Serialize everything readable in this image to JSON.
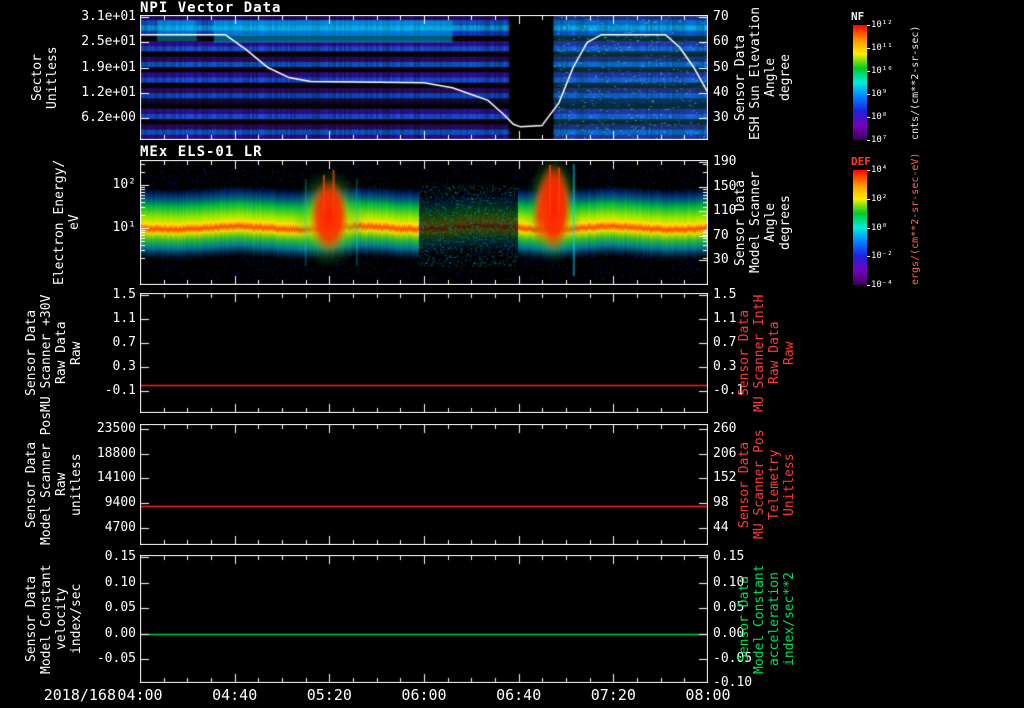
{
  "x_axis": {
    "date_label": "2018/168",
    "tick_labels": [
      "04:00",
      "04:40",
      "05:20",
      "06:00",
      "06:40",
      "07:20",
      "08:00"
    ],
    "start_hour": 4,
    "end_hour": 8
  },
  "panels": [
    {
      "title": "NPI Vector Data",
      "left_label_lines": [
        "Sector",
        "Unitless"
      ],
      "left_ticks": [
        "3.1e+01",
        "2.5e+01",
        "1.9e+01",
        "1.2e+01",
        "6.2e+00"
      ],
      "right_ticks": [
        "70",
        "60",
        "50",
        "40",
        "30"
      ],
      "right_label_lines": [
        "Sensor Data",
        "ESH Sun Elevation",
        "Angle",
        "degree"
      ],
      "right_label_color": "#ffffff"
    },
    {
      "title": "MEx ELS-01 LR",
      "left_label_lines": [
        "Electron Energy/",
        "eV"
      ],
      "left_ticks": [
        "10²",
        "10¹"
      ],
      "right_ticks": [
        "190",
        "150",
        "110",
        "70",
        "30"
      ],
      "right_label_lines": [
        "Sensor Data",
        "Model Scanner",
        "Angle",
        "degrees"
      ],
      "right_label_color": "#ffffff"
    },
    {
      "title": "",
      "left_label_lines": [
        "Sensor Data",
        "MU Scanner +30V",
        "Raw Data",
        "Raw"
      ],
      "left_ticks": [
        "1.5",
        "1.1",
        "0.7",
        "0.3",
        "-0.1"
      ],
      "right_ticks": [
        "1.5",
        "1.1",
        "0.7",
        "0.3",
        "-0.1"
      ],
      "right_label_lines": [
        "Sensor Data",
        "MU Scanner IntH",
        "Raw Data",
        "Raw"
      ],
      "right_label_color": "#ff3b30"
    },
    {
      "title": "",
      "left_label_lines": [
        "Sensor Data",
        "Model Scanner Pos",
        "Raw",
        "unitless"
      ],
      "left_ticks": [
        "23500",
        "18800",
        "14100",
        "9400",
        "4700"
      ],
      "right_ticks": [
        "260",
        "206",
        "152",
        "98",
        "44"
      ],
      "right_label_lines": [
        "Sensor Data",
        "MU Scanner Pos",
        "Telemetry",
        "Unitless"
      ],
      "right_label_color": "#ff3b30"
    },
    {
      "title": "",
      "left_label_lines": [
        "Sensor Data",
        "Model Constant",
        "velocity",
        "index/sec"
      ],
      "left_ticks": [
        "0.15",
        "0.10",
        "0.05",
        "0.00",
        "-0.05"
      ],
      "right_ticks": [
        "0.15",
        "0.10",
        "0.05",
        "0.00",
        "-0.05",
        "-0.10"
      ],
      "right_label_lines": [
        "Sensor Data",
        "Model Constant",
        "acceleration",
        "index/sec**2"
      ],
      "right_label_color": "#00e050"
    }
  ],
  "colorbars": [
    {
      "label": "NF",
      "label_color": "#f0f0f0",
      "tick_labels": [
        "10¹²",
        "10¹¹",
        "10¹⁰",
        "10⁹",
        "10⁸",
        "10⁷"
      ],
      "units": "cnts/(cm**2-sr-sec)",
      "units_color": "#e8e8e8",
      "colors": [
        "#ff0000",
        "#ff9000",
        "#ffee00",
        "#00cc22",
        "#00eedd",
        "#0080ff",
        "#2020dd",
        "#7700bb",
        "#3a0055"
      ]
    },
    {
      "label": "DEF",
      "label_color": "#ff3b30",
      "tick_labels": [
        "10⁴",
        "10²",
        "10⁰",
        "10⁻²",
        "10⁻⁴"
      ],
      "units": "ergs/(cm**2-sr-sec-eV)",
      "units_color": "#ff6a5a",
      "colors": [
        "#ff0000",
        "#ff9000",
        "#ffee00",
        "#00cc22",
        "#00eedd",
        "#0080ff",
        "#2020dd",
        "#7700bb",
        "#3a0055"
      ]
    }
  ],
  "chart_data": [
    {
      "type": "heatmap",
      "title": "NPI Vector Data",
      "ylabel": "Sector (Unitless)",
      "ytick_labels": [
        "3.1e+01",
        "2.5e+01",
        "1.9e+01",
        "1.2e+01",
        "6.2e+00"
      ],
      "yticks": [
        31,
        25,
        19,
        12,
        6.2
      ],
      "x_range_hours": [
        4,
        8
      ],
      "xtick_labels": [
        "04:00",
        "04:40",
        "05:20",
        "06:00",
        "06:40",
        "07:20",
        "08:00"
      ],
      "colorbar": {
        "label": "NF",
        "units": "cnts/(cm**2-sr-sec)",
        "tick_labels": [
          "10¹²",
          "10¹¹",
          "10¹⁰",
          "10⁹",
          "10⁸",
          "10⁷"
        ]
      },
      "features": {
        "description": "Horizontal sector bands in blue/violet with cyan enhancements; black telemetry gap near 06:39-06:58; brighter cyan speckle after the gap.",
        "data_gap_frac": [
          0.65,
          0.728
        ],
        "cyan_patch_frac": [
          0.13,
          0.55
        ],
        "row_colors": [
          "#2a0b66",
          "#0b5bd6",
          "#00a8e8",
          "#0b3fd0",
          "#050505",
          "#30109a",
          "#1a4fe0",
          "#050505",
          "#2a0b66",
          "#0b5bd6",
          "#050505",
          "#30109a",
          "#1a4fe0",
          "#050505",
          "#2a0b66",
          "#0b4fd0",
          "#140a3a",
          "#050505",
          "#30109a",
          "#1a4fe0",
          "#050505",
          "#2a0b66",
          "#0b5bd6",
          "#30109a"
        ]
      },
      "overlay_line": {
        "name": "ESH Sun Elevation Angle (degree)",
        "color": "#ffffff",
        "axis": "right",
        "right_ticks": [
          70,
          60,
          50,
          40,
          30
        ],
        "points_hours_deg": [
          [
            4.0,
            63
          ],
          [
            4.6,
            63
          ],
          [
            4.75,
            57
          ],
          [
            4.9,
            50
          ],
          [
            5.05,
            46
          ],
          [
            5.2,
            44.5
          ],
          [
            6.0,
            44
          ],
          [
            6.2,
            42
          ],
          [
            6.45,
            37
          ],
          [
            6.55,
            32
          ],
          [
            6.63,
            27.5
          ],
          [
            6.68,
            26.5
          ],
          [
            6.83,
            27
          ],
          [
            6.95,
            36
          ],
          [
            7.05,
            50
          ],
          [
            7.15,
            60
          ],
          [
            7.25,
            63
          ],
          [
            7.7,
            63
          ],
          [
            7.8,
            58
          ],
          [
            7.9,
            50
          ],
          [
            8.0,
            40
          ]
        ]
      }
    },
    {
      "type": "heatmap",
      "title": "MEx ELS-01 LR",
      "ylabel": "Electron Energy/eV",
      "yscale": "log",
      "ytick_labels": [
        "10²",
        "10¹"
      ],
      "x_range_hours": [
        4,
        8
      ],
      "right_axis": {
        "label": "Sensor Data Model Scanner Angle degrees",
        "ticks": [
          190,
          150,
          110,
          70,
          30
        ]
      },
      "colorbar": {
        "label": "DEF",
        "units": "ergs/(cm**2-sr-sec-eV)",
        "tick_labels": [
          "10⁴",
          "10²",
          "10⁰",
          "10⁻²",
          "10⁻⁴"
        ]
      },
      "features": {
        "description": "Continuous green-yellow electron band ~8-40 eV with a red-flux core; intense red enhancements near 05:20 and 06:55 reaching above 100 eV; dim speckled interval 06:00-06:40.",
        "main_band_energy_ev": [
          8,
          40
        ],
        "red_blob_center_frac": [
          0.333,
          0.728
        ],
        "quiet_interval_frac": [
          0.49,
          0.665
        ]
      }
    },
    {
      "type": "line",
      "series": [
        {
          "name": "MU Scanner +30V Raw",
          "color": "#ff2222",
          "constant_value": 0.0
        }
      ],
      "yticks": [
        1.5,
        1.1,
        0.7,
        0.3,
        -0.1
      ],
      "right_axis": {
        "label": "Sensor Data MU Scanner IntH Raw Data Raw",
        "ticks": [
          1.5,
          1.1,
          0.7,
          0.3,
          -0.1
        ]
      }
    },
    {
      "type": "line",
      "series": [
        {
          "name": "Model Scanner Pos Raw",
          "color": "#ff2222",
          "constant_value": 8800
        }
      ],
      "yticks": [
        23500,
        18800,
        14100,
        9400,
        4700
      ],
      "right_axis": {
        "label": "Sensor Data MU Scanner Pos Telemetry Unitless",
        "ticks": [
          260,
          206,
          152,
          98,
          44
        ]
      }
    },
    {
      "type": "line",
      "series": [
        {
          "name": "Model Constant velocity",
          "color": "#00cc44",
          "constant_value": 0.0
        }
      ],
      "yticks": [
        0.15,
        0.1,
        0.05,
        0.0,
        -0.05
      ],
      "right_axis": {
        "label": "Sensor Data Model Constant acceleration index/sec**2",
        "ticks": [
          0.15,
          0.1,
          0.05,
          0.0,
          -0.05,
          -0.1
        ]
      }
    }
  ]
}
